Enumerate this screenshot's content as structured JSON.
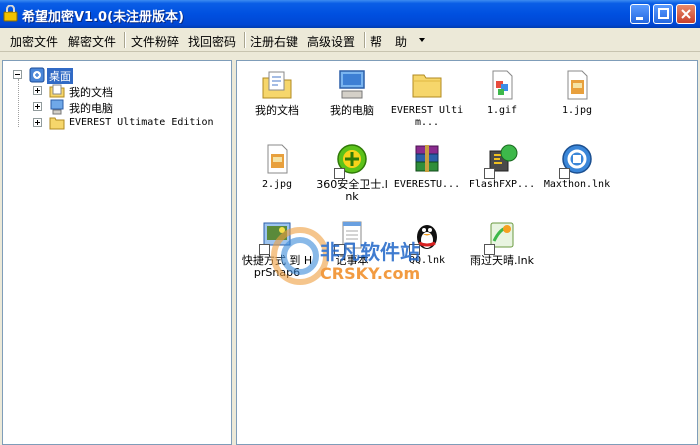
{
  "window": {
    "title": "希望加密V1.0(未注册版本)"
  },
  "menu": {
    "items": [
      "加密文件",
      "解密文件",
      "文件粉碎",
      "找回密码",
      "注册右键",
      "高级设置",
      "帮",
      "助"
    ]
  },
  "tree": {
    "root": "桌面",
    "children": [
      "我的文档",
      "我的电脑",
      "EVEREST Ultimate Edition"
    ]
  },
  "files": [
    {
      "name": "我的文档",
      "icon": "documents-folder-icon"
    },
    {
      "name": "我的电脑",
      "icon": "computer-icon"
    },
    {
      "name": "EVEREST Ultim...",
      "icon": "folder-icon"
    },
    {
      "name": "1.gif",
      "icon": "gif-image-icon"
    },
    {
      "name": "1.jpg",
      "icon": "jpg-image-icon"
    },
    {
      "name": "2.jpg",
      "icon": "jpg-image-icon"
    },
    {
      "name": "360安全卫士.lnk",
      "icon": "360-safeguard-icon"
    },
    {
      "name": "EVERESTU...",
      "icon": "winrar-archive-icon"
    },
    {
      "name": "FlashFXP...",
      "icon": "flashfxp-icon"
    },
    {
      "name": "Maxthon.lnk",
      "icon": "maxthon-browser-icon"
    },
    {
      "name": "快捷方式 到 HprSnap6",
      "icon": "hypersnap-icon"
    },
    {
      "name": "记事本",
      "icon": "notepad-icon"
    },
    {
      "name": "QQ.lnk",
      "icon": "qq-penguin-icon"
    },
    {
      "name": "雨过天晴.lnk",
      "icon": "rain-sun-icon"
    }
  ],
  "watermark": {
    "cn": "非凡软件站",
    "en": "CRSKY.com"
  }
}
